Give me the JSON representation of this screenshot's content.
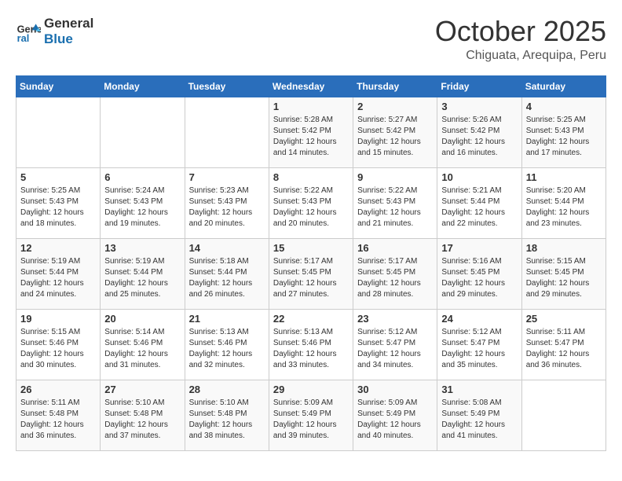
{
  "header": {
    "logo_line1": "General",
    "logo_line2": "Blue",
    "month": "October 2025",
    "location": "Chiguata, Arequipa, Peru"
  },
  "weekdays": [
    "Sunday",
    "Monday",
    "Tuesday",
    "Wednesday",
    "Thursday",
    "Friday",
    "Saturday"
  ],
  "weeks": [
    [
      {
        "day": "",
        "info": ""
      },
      {
        "day": "",
        "info": ""
      },
      {
        "day": "",
        "info": ""
      },
      {
        "day": "1",
        "info": "Sunrise: 5:28 AM\nSunset: 5:42 PM\nDaylight: 12 hours\nand 14 minutes."
      },
      {
        "day": "2",
        "info": "Sunrise: 5:27 AM\nSunset: 5:42 PM\nDaylight: 12 hours\nand 15 minutes."
      },
      {
        "day": "3",
        "info": "Sunrise: 5:26 AM\nSunset: 5:42 PM\nDaylight: 12 hours\nand 16 minutes."
      },
      {
        "day": "4",
        "info": "Sunrise: 5:25 AM\nSunset: 5:43 PM\nDaylight: 12 hours\nand 17 minutes."
      }
    ],
    [
      {
        "day": "5",
        "info": "Sunrise: 5:25 AM\nSunset: 5:43 PM\nDaylight: 12 hours\nand 18 minutes."
      },
      {
        "day": "6",
        "info": "Sunrise: 5:24 AM\nSunset: 5:43 PM\nDaylight: 12 hours\nand 19 minutes."
      },
      {
        "day": "7",
        "info": "Sunrise: 5:23 AM\nSunset: 5:43 PM\nDaylight: 12 hours\nand 20 minutes."
      },
      {
        "day": "8",
        "info": "Sunrise: 5:22 AM\nSunset: 5:43 PM\nDaylight: 12 hours\nand 20 minutes."
      },
      {
        "day": "9",
        "info": "Sunrise: 5:22 AM\nSunset: 5:43 PM\nDaylight: 12 hours\nand 21 minutes."
      },
      {
        "day": "10",
        "info": "Sunrise: 5:21 AM\nSunset: 5:44 PM\nDaylight: 12 hours\nand 22 minutes."
      },
      {
        "day": "11",
        "info": "Sunrise: 5:20 AM\nSunset: 5:44 PM\nDaylight: 12 hours\nand 23 minutes."
      }
    ],
    [
      {
        "day": "12",
        "info": "Sunrise: 5:19 AM\nSunset: 5:44 PM\nDaylight: 12 hours\nand 24 minutes."
      },
      {
        "day": "13",
        "info": "Sunrise: 5:19 AM\nSunset: 5:44 PM\nDaylight: 12 hours\nand 25 minutes."
      },
      {
        "day": "14",
        "info": "Sunrise: 5:18 AM\nSunset: 5:44 PM\nDaylight: 12 hours\nand 26 minutes."
      },
      {
        "day": "15",
        "info": "Sunrise: 5:17 AM\nSunset: 5:45 PM\nDaylight: 12 hours\nand 27 minutes."
      },
      {
        "day": "16",
        "info": "Sunrise: 5:17 AM\nSunset: 5:45 PM\nDaylight: 12 hours\nand 28 minutes."
      },
      {
        "day": "17",
        "info": "Sunrise: 5:16 AM\nSunset: 5:45 PM\nDaylight: 12 hours\nand 29 minutes."
      },
      {
        "day": "18",
        "info": "Sunrise: 5:15 AM\nSunset: 5:45 PM\nDaylight: 12 hours\nand 29 minutes."
      }
    ],
    [
      {
        "day": "19",
        "info": "Sunrise: 5:15 AM\nSunset: 5:46 PM\nDaylight: 12 hours\nand 30 minutes."
      },
      {
        "day": "20",
        "info": "Sunrise: 5:14 AM\nSunset: 5:46 PM\nDaylight: 12 hours\nand 31 minutes."
      },
      {
        "day": "21",
        "info": "Sunrise: 5:13 AM\nSunset: 5:46 PM\nDaylight: 12 hours\nand 32 minutes."
      },
      {
        "day": "22",
        "info": "Sunrise: 5:13 AM\nSunset: 5:46 PM\nDaylight: 12 hours\nand 33 minutes."
      },
      {
        "day": "23",
        "info": "Sunrise: 5:12 AM\nSunset: 5:47 PM\nDaylight: 12 hours\nand 34 minutes."
      },
      {
        "day": "24",
        "info": "Sunrise: 5:12 AM\nSunset: 5:47 PM\nDaylight: 12 hours\nand 35 minutes."
      },
      {
        "day": "25",
        "info": "Sunrise: 5:11 AM\nSunset: 5:47 PM\nDaylight: 12 hours\nand 36 minutes."
      }
    ],
    [
      {
        "day": "26",
        "info": "Sunrise: 5:11 AM\nSunset: 5:48 PM\nDaylight: 12 hours\nand 36 minutes."
      },
      {
        "day": "27",
        "info": "Sunrise: 5:10 AM\nSunset: 5:48 PM\nDaylight: 12 hours\nand 37 minutes."
      },
      {
        "day": "28",
        "info": "Sunrise: 5:10 AM\nSunset: 5:48 PM\nDaylight: 12 hours\nand 38 minutes."
      },
      {
        "day": "29",
        "info": "Sunrise: 5:09 AM\nSunset: 5:49 PM\nDaylight: 12 hours\nand 39 minutes."
      },
      {
        "day": "30",
        "info": "Sunrise: 5:09 AM\nSunset: 5:49 PM\nDaylight: 12 hours\nand 40 minutes."
      },
      {
        "day": "31",
        "info": "Sunrise: 5:08 AM\nSunset: 5:49 PM\nDaylight: 12 hours\nand 41 minutes."
      },
      {
        "day": "",
        "info": ""
      }
    ]
  ]
}
